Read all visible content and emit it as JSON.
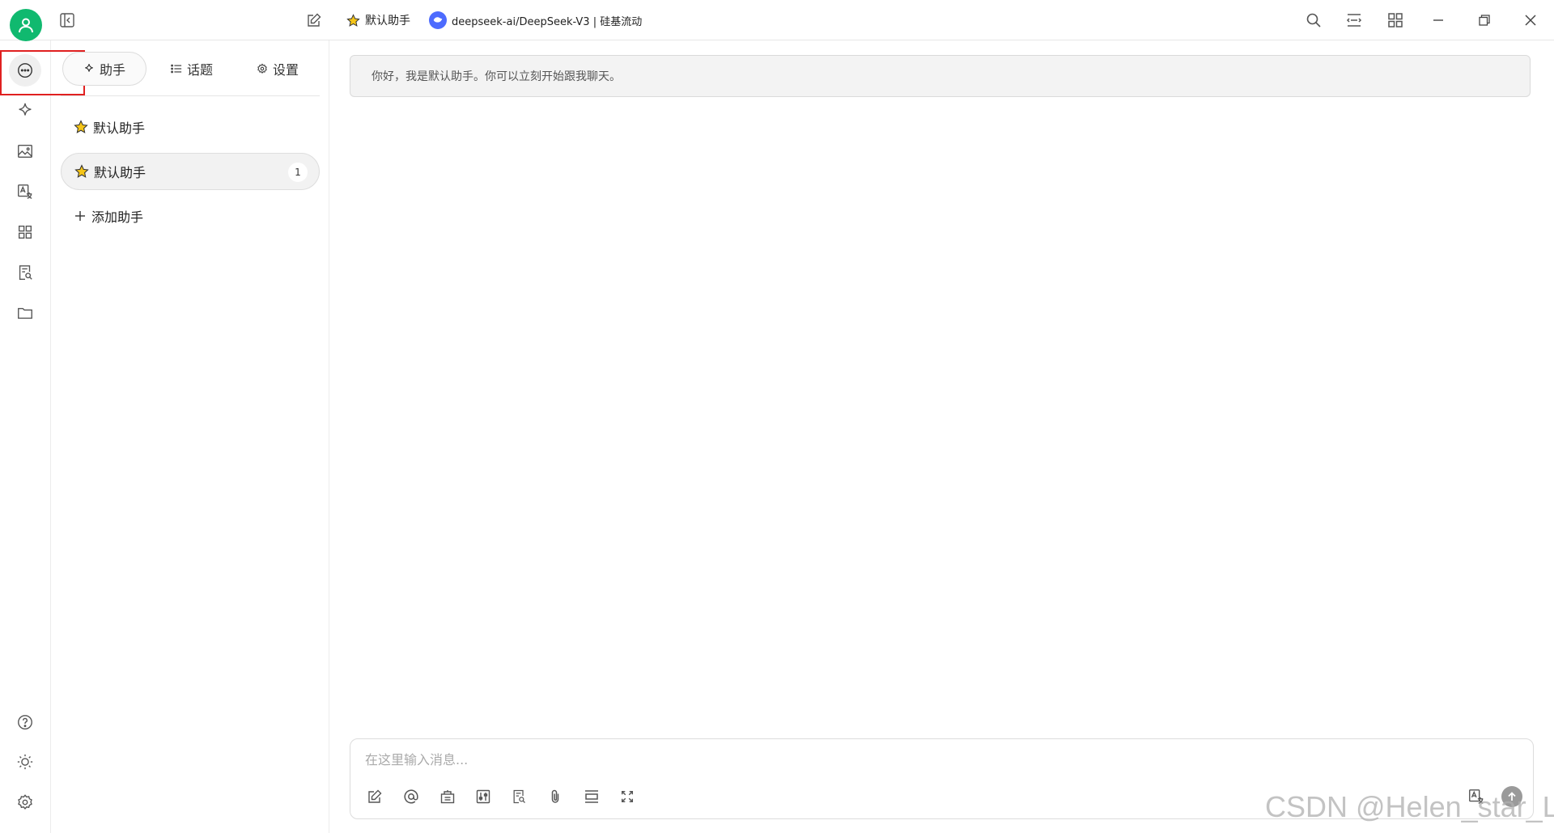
{
  "titlebar": {
    "assistant_name": "默认助手",
    "model_label": "deepseek-ai/DeepSeek-V3 | 硅基流动"
  },
  "sidebar": {
    "tabs": [
      {
        "label": "助手",
        "icon": "sparkle-icon",
        "active": true
      },
      {
        "label": "话题",
        "icon": "list-icon",
        "active": false
      },
      {
        "label": "设置",
        "icon": "gear-icon",
        "active": false
      }
    ],
    "assistants": [
      {
        "label": "默认助手",
        "icon": "star-icon"
      },
      {
        "label": "默认助手",
        "icon": "star-icon",
        "badge": "1",
        "active": true
      }
    ],
    "add_label": "添加助手"
  },
  "chat": {
    "greeting": "你好，我是默认助手。你可以立刻开始跟我聊天。"
  },
  "composer": {
    "placeholder": "在这里输入消息..."
  },
  "watermark": "CSDN @Helen_star_L",
  "colors": {
    "avatar": "#10b96f",
    "highlight": "#e02020",
    "model_logo": "#4d6bfe",
    "star": "#f5c518"
  }
}
